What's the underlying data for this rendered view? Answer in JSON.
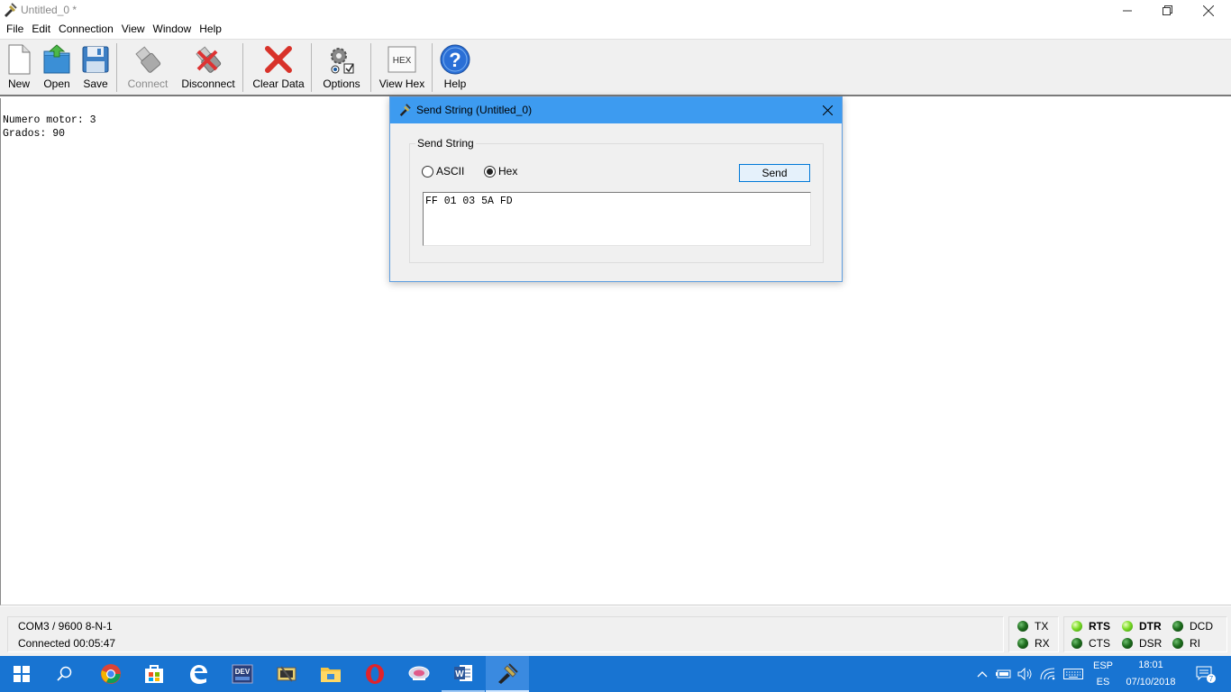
{
  "window": {
    "title": "Untitled_0 *"
  },
  "menu": [
    "File",
    "Edit",
    "Connection",
    "View",
    "Window",
    "Help"
  ],
  "toolbar": {
    "new": "New",
    "open": "Open",
    "save": "Save",
    "connect": "Connect",
    "disconnect": "Disconnect",
    "clear_data": "Clear Data",
    "options": "Options",
    "view_hex": "View Hex",
    "view_hex_icon_text": "HEX",
    "help": "Help"
  },
  "terminal": {
    "lines": [
      "Numero motor: 3",
      "Grados: 90"
    ]
  },
  "dialog": {
    "title": "Send String (Untitled_0)",
    "group_label": "Send String",
    "radio_ascii": "ASCII",
    "radio_hex": "Hex",
    "selected": "Hex",
    "send_label": "Send",
    "input_value": "FF 01 03 5A FD"
  },
  "status": {
    "port": "COM3 / 9600 8-N-1",
    "connection": "Connected 00:05:47",
    "leds": {
      "tx": {
        "label": "TX",
        "on": false
      },
      "rx": {
        "label": "RX",
        "on": false
      },
      "rts": {
        "label": "RTS",
        "on": true
      },
      "cts": {
        "label": "CTS",
        "on": false
      },
      "dtr": {
        "label": "DTR",
        "on": true
      },
      "dsr": {
        "label": "DSR",
        "on": false
      },
      "dcd": {
        "label": "DCD",
        "on": false
      },
      "ri": {
        "label": "RI",
        "on": false
      }
    }
  },
  "taskbar": {
    "language_top": "ESP",
    "language_bottom": "ES",
    "time": "18:01",
    "date": "07/10/2018",
    "notification_count": "7",
    "dev_icon_text": "DEV"
  },
  "colors": {
    "dialog_title": "#3d9bf0",
    "taskbar": "#1874d2",
    "send_button_border": "#0078d7"
  }
}
